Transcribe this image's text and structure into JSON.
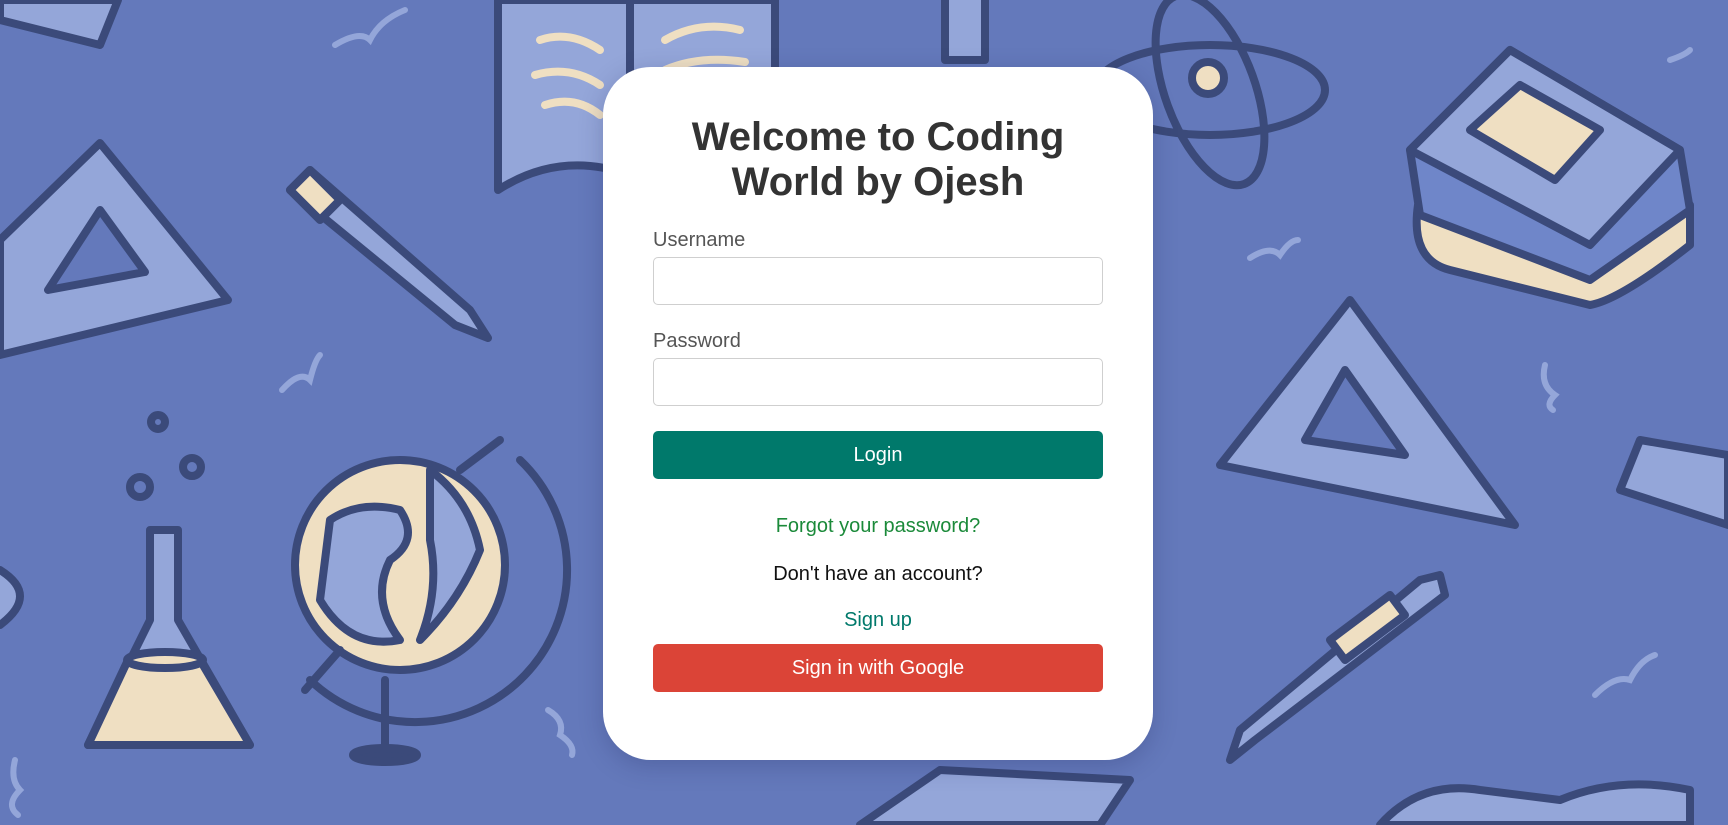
{
  "background": {
    "color": "#6479bb",
    "illustration_items": [
      "ruler-icon",
      "open-book-icon",
      "atom-icon",
      "flask-icon",
      "stacked-books-icon",
      "triangle-ruler-icon",
      "pencil-icon",
      "globe-icon",
      "pen-icon",
      "beaker-icon"
    ]
  },
  "card": {
    "title": "Welcome to Coding World by Ojesh",
    "username_label": "Username",
    "username_value": "",
    "password_label": "Password",
    "password_value": "",
    "login_label": "Login",
    "forgot_label": "Forgot your password?",
    "no_account_text": "Don't have an account?",
    "signup_label": "Sign up",
    "google_label": "Sign in with Google"
  },
  "colors": {
    "primary": "#00796b",
    "google": "#db4437",
    "forgot_link": "#1b8a3a",
    "card_bg": "#ffffff"
  }
}
